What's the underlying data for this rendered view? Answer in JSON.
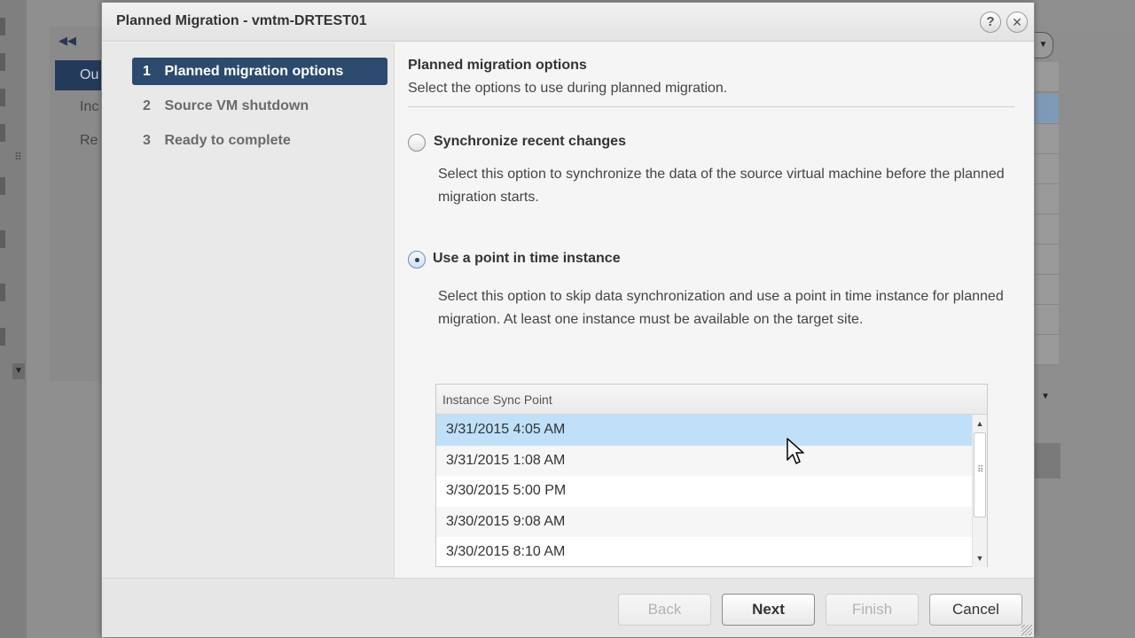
{
  "dialog": {
    "title": "Planned Migration - vmtm-DRTEST01",
    "help_glyph": "?",
    "close_glyph": "✕"
  },
  "background": {
    "nav_items": [
      {
        "label": "Ou",
        "active": true
      },
      {
        "label": "Inc",
        "active": false
      },
      {
        "label": "Re",
        "active": false
      }
    ],
    "collapse_glyph": "◀◀",
    "grip_glyph": "⠿"
  },
  "steps": [
    {
      "num": "1",
      "label": "Planned migration options",
      "active": true
    },
    {
      "num": "2",
      "label": "Source VM shutdown",
      "active": false
    },
    {
      "num": "3",
      "label": "Ready to complete",
      "active": false
    }
  ],
  "page": {
    "title": "Planned migration options",
    "subtitle": "Select the options to use during planned migration."
  },
  "options": [
    {
      "label": "Synchronize recent changes",
      "checked": false,
      "description": "Select this option to synchronize the data of the source virtual machine before the planned migration starts."
    },
    {
      "label": "Use a point in time instance",
      "checked": true,
      "description": "Select this option to skip data synchronization and use a point in time instance for planned migration. At least one instance must be available on the target site."
    }
  ],
  "instance_table": {
    "header": "Instance Sync Point",
    "rows": [
      {
        "value": "3/31/2015 4:05 AM",
        "selected": true
      },
      {
        "value": "3/31/2015 1:08 AM",
        "selected": false
      },
      {
        "value": "3/30/2015 5:00 PM",
        "selected": false
      },
      {
        "value": "3/30/2015 9:08 AM",
        "selected": false
      },
      {
        "value": "3/30/2015 8:10 AM",
        "selected": false
      }
    ],
    "scroll_up_glyph": "▲",
    "scroll_down_glyph": "▼",
    "grip_glyph": "⠿"
  },
  "footer": {
    "back": "Back",
    "next": "Next",
    "finish": "Finish",
    "cancel": "Cancel"
  },
  "colors": {
    "active_step": "#2c4a6e",
    "selected_row": "#bfe0f8"
  }
}
